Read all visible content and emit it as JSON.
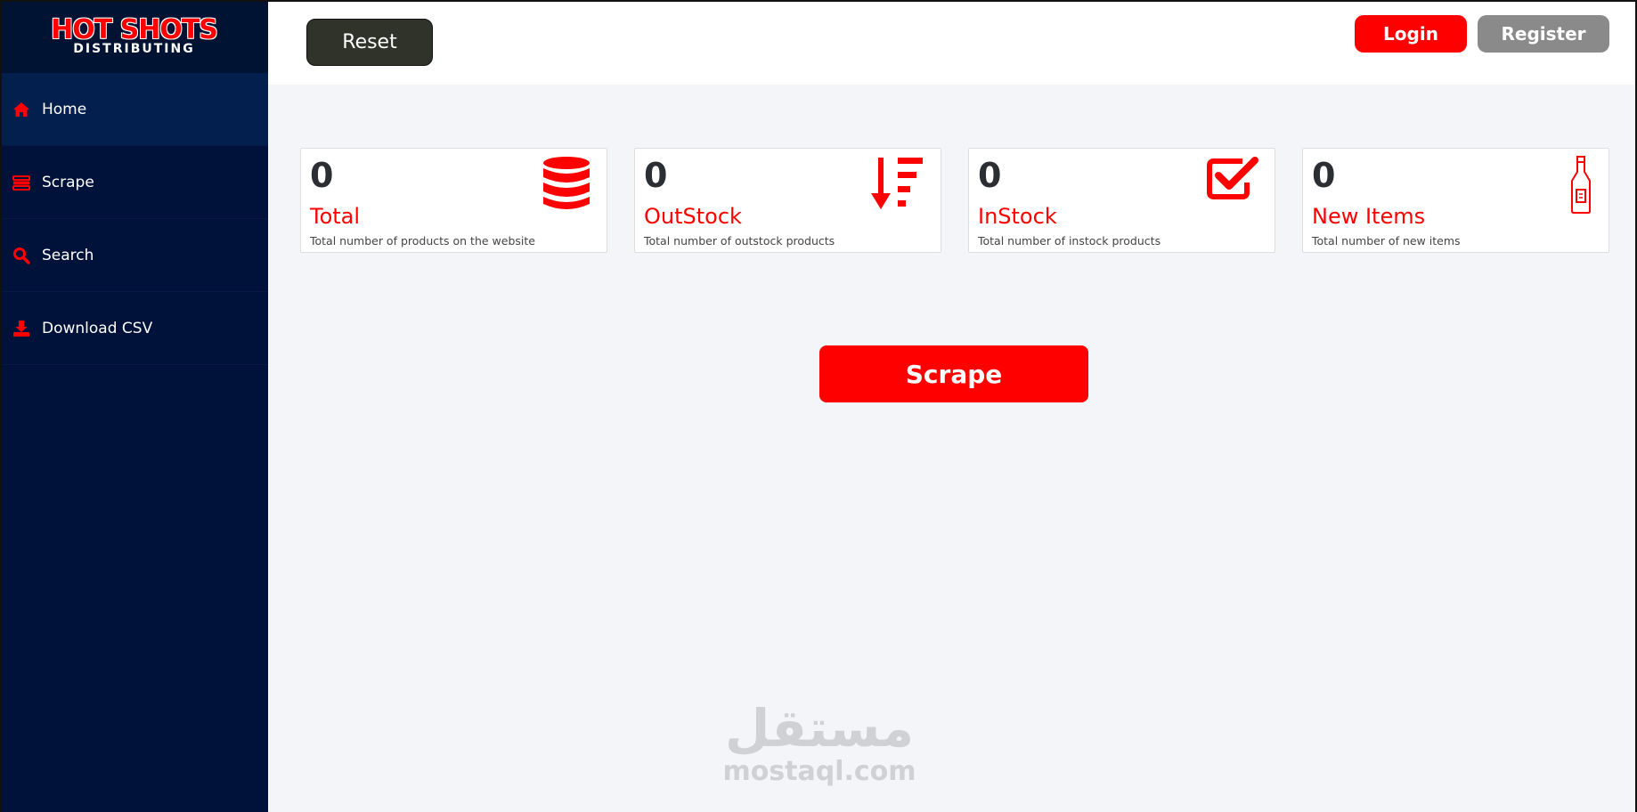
{
  "brand": {
    "logo_line1": "HOT SHOTS",
    "logo_line2": "DISTRIBUTING",
    "accent_color": "#ff0000",
    "sidebar_color": "#00123a"
  },
  "sidebar": {
    "items": [
      {
        "label": "Home",
        "icon": "home-icon",
        "active": true
      },
      {
        "label": "Scrape",
        "icon": "server-icon",
        "active": false
      },
      {
        "label": "Search",
        "icon": "search-icon",
        "active": false
      },
      {
        "label": "Download CSV",
        "icon": "download-icon",
        "active": false
      }
    ]
  },
  "topbar": {
    "reset_label": "Reset",
    "login_label": "Login",
    "register_label": "Register"
  },
  "cards": [
    {
      "count": "0",
      "title": "Total",
      "desc": "Total number of products on the website",
      "icon": "database-icon"
    },
    {
      "count": "0",
      "title": "OutStock",
      "desc": "Total number of outstock products",
      "icon": "sort-down-icon"
    },
    {
      "count": "0",
      "title": "InStock",
      "desc": "Total number of instock products",
      "icon": "checkbox-icon"
    },
    {
      "count": "0",
      "title": "New Items",
      "desc": "Total number of new items",
      "icon": "bottle-icon"
    }
  ],
  "main": {
    "scrape_label": "Scrape"
  },
  "watermark": {
    "arabic": "مستقل",
    "latin": "mostaql.com"
  }
}
